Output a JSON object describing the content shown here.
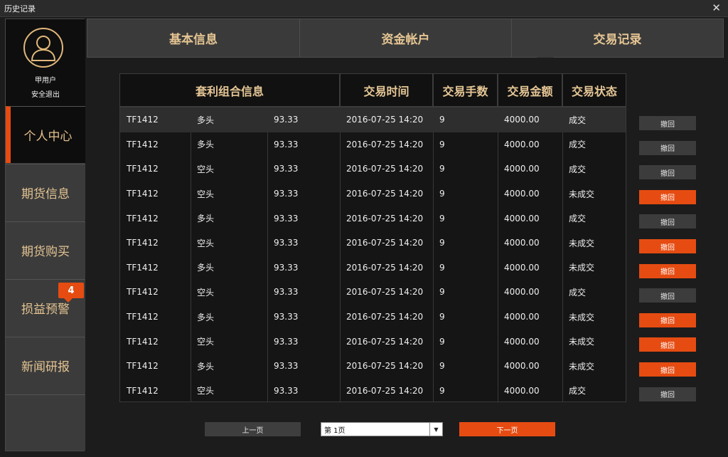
{
  "window": {
    "title": "历史记录",
    "close_glyph": "✕"
  },
  "user": {
    "name": "甲用户",
    "logout": "安全退出",
    "avatar_icon": "user-silhouette-icon"
  },
  "nav": [
    {
      "label": "个人中心",
      "active": true
    },
    {
      "label": "期货信息"
    },
    {
      "label": "期货购买"
    },
    {
      "label": "损益预警",
      "badge": "4"
    },
    {
      "label": "新闻研报"
    }
  ],
  "tabs": [
    {
      "label": "基本信息"
    },
    {
      "label": "资金帐户"
    },
    {
      "label": "交易记录",
      "active": true
    }
  ],
  "table": {
    "headers": [
      "套利组合信息",
      "交易时间",
      "交易手数",
      "交易金额",
      "交易状态"
    ],
    "rows": [
      {
        "code": "TF1412",
        "dir": "多头",
        "price": "93.33",
        "time": "2016-07-25 14:20",
        "lots": "9",
        "amount": "4000.00",
        "status": "成交",
        "action": "撤回",
        "hot": false
      },
      {
        "code": "TF1412",
        "dir": "多头",
        "price": "93.33",
        "time": "2016-07-25 14:20",
        "lots": "9",
        "amount": "4000.00",
        "status": "成交",
        "action": "撤回",
        "hot": false
      },
      {
        "code": "TF1412",
        "dir": "空头",
        "price": "93.33",
        "time": "2016-07-25 14:20",
        "lots": "9",
        "amount": "4000.00",
        "status": "成交",
        "action": "撤回",
        "hot": false
      },
      {
        "code": "TF1412",
        "dir": "空头",
        "price": "93.33",
        "time": "2016-07-25 14:20",
        "lots": "9",
        "amount": "4000.00",
        "status": "未成交",
        "action": "撤回",
        "hot": true
      },
      {
        "code": "TF1412",
        "dir": "多头",
        "price": "93.33",
        "time": "2016-07-25 14:20",
        "lots": "9",
        "amount": "4000.00",
        "status": "成交",
        "action": "撤回",
        "hot": false
      },
      {
        "code": "TF1412",
        "dir": "空头",
        "price": "93.33",
        "time": "2016-07-25 14:20",
        "lots": "9",
        "amount": "4000.00",
        "status": "未成交",
        "action": "撤回",
        "hot": true
      },
      {
        "code": "TF1412",
        "dir": "多头",
        "price": "93.33",
        "time": "2016-07-25 14:20",
        "lots": "9",
        "amount": "4000.00",
        "status": "未成交",
        "action": "撤回",
        "hot": true
      },
      {
        "code": "TF1412",
        "dir": "空头",
        "price": "93.33",
        "time": "2016-07-25 14:20",
        "lots": "9",
        "amount": "4000.00",
        "status": "成交",
        "action": "撤回",
        "hot": false
      },
      {
        "code": "TF1412",
        "dir": "多头",
        "price": "93.33",
        "time": "2016-07-25 14:20",
        "lots": "9",
        "amount": "4000.00",
        "status": "未成交",
        "action": "撤回",
        "hot": true
      },
      {
        "code": "TF1412",
        "dir": "空头",
        "price": "93.33",
        "time": "2016-07-25 14:20",
        "lots": "9",
        "amount": "4000.00",
        "status": "未成交",
        "action": "撤回",
        "hot": true
      },
      {
        "code": "TF1412",
        "dir": "多头",
        "price": "93.33",
        "time": "2016-07-25 14:20",
        "lots": "9",
        "amount": "4000.00",
        "status": "未成交",
        "action": "撤回",
        "hot": true
      },
      {
        "code": "TF1412",
        "dir": "空头",
        "price": "93.33",
        "time": "2016-07-25 14:20",
        "lots": "9",
        "amount": "4000.00",
        "status": "成交",
        "action": "撤回",
        "hot": false
      }
    ]
  },
  "pager": {
    "prev": "上一页",
    "page_select": "第 1页",
    "next": "下一页",
    "dropdown_icon": "triangle-down-icon"
  },
  "colors": {
    "accent": "#e64c12",
    "gold_text": "#e5c593",
    "bg": "#1c1c1c"
  }
}
